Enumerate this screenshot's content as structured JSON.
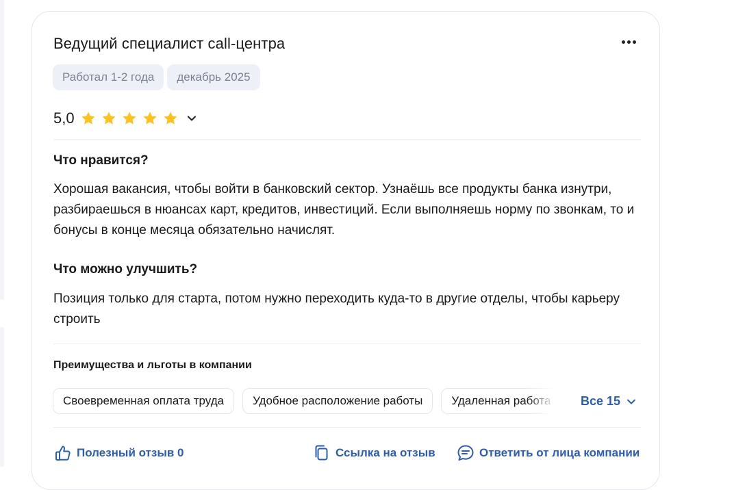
{
  "review": {
    "title": "Ведущий специалист call-центра",
    "tags": [
      "Работал 1-2 года",
      "декабрь 2025"
    ],
    "rating": "5,0",
    "stars": 5,
    "likes_heading": "Что нравится?",
    "likes_text": "Хорошая вакансия, чтобы войти в банковский сектор. Узнаёшь все продукты банка изнутри, разбираешься в нюансах карт, кредитов, инвестиций. Если выполняешь норму по звонкам, то и бонусы в конце месяца обязательно начислят.",
    "improve_heading": "Что можно улучшить?",
    "improve_text": "Позиция только для старта, потом нужно переходить куда-то в другие отделы, чтобы карьеру строить"
  },
  "benefits": {
    "heading": "Преимущества и льготы в компании",
    "items": [
      "Своевременная оплата труда",
      "Удобное расположение работы",
      "Удаленная работа"
    ],
    "all_label": "Все 15"
  },
  "actions": {
    "helpful": "Полезный отзыв 0",
    "link": "Ссылка на отзыв",
    "reply": "Ответить от лица компании"
  },
  "colors": {
    "star": "#ffc21a",
    "link": "#2a5db8",
    "tag_bg": "#edf0f6"
  },
  "icons": [
    "more-icon",
    "star-icon",
    "chevron-down-icon",
    "thumbs-up-icon",
    "copy-link-icon",
    "chat-reply-icon"
  ]
}
